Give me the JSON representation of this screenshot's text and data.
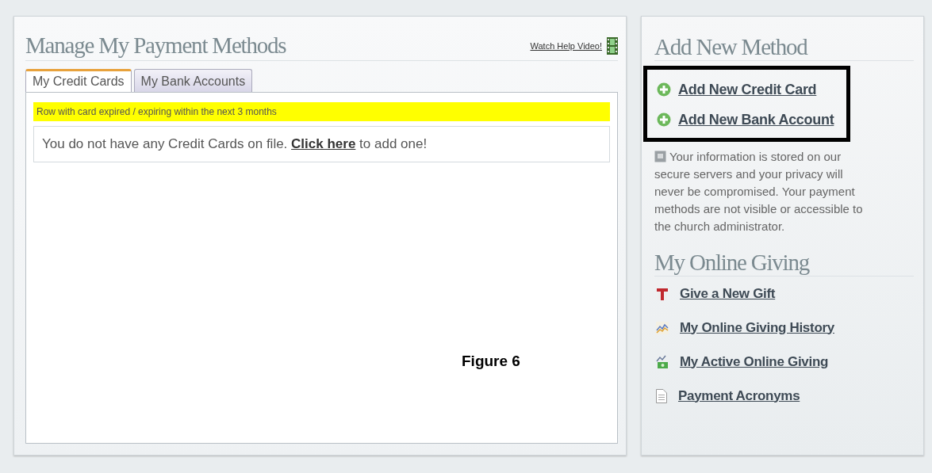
{
  "main": {
    "title": "Manage My Payment Methods",
    "help_link": "Watch Help Video!",
    "tabs": [
      {
        "label": "My Credit Cards",
        "selected": true
      },
      {
        "label": "My Bank Accounts",
        "selected": false
      }
    ],
    "legend": {
      "text": "Row with card expired / expiring within the next 3 months",
      "color": "#ffff00"
    },
    "message": {
      "before": "You do not have any Credit Cards on file. ",
      "link": "Click here",
      "after": " to add one!"
    },
    "caption": "Figure 6"
  },
  "sidebar": {
    "add_title": "Add New Method",
    "add_highlighted": true,
    "add_links": [
      "Add New Credit Card",
      "Add New Bank Account"
    ],
    "info": "Your information is stored on our secure servers and your privacy will never be compromised. Your payment methods are not visible or accessible to the church administrator.",
    "giving_title": "My Online Giving",
    "giving_links": [
      {
        "kind": "gift",
        "label": "Give a New Gift"
      },
      {
        "kind": "history",
        "label": "My Online Giving History"
      },
      {
        "kind": "active",
        "label": "My Active Online Giving"
      },
      {
        "kind": "document",
        "label": "Payment Acronyms"
      }
    ]
  }
}
